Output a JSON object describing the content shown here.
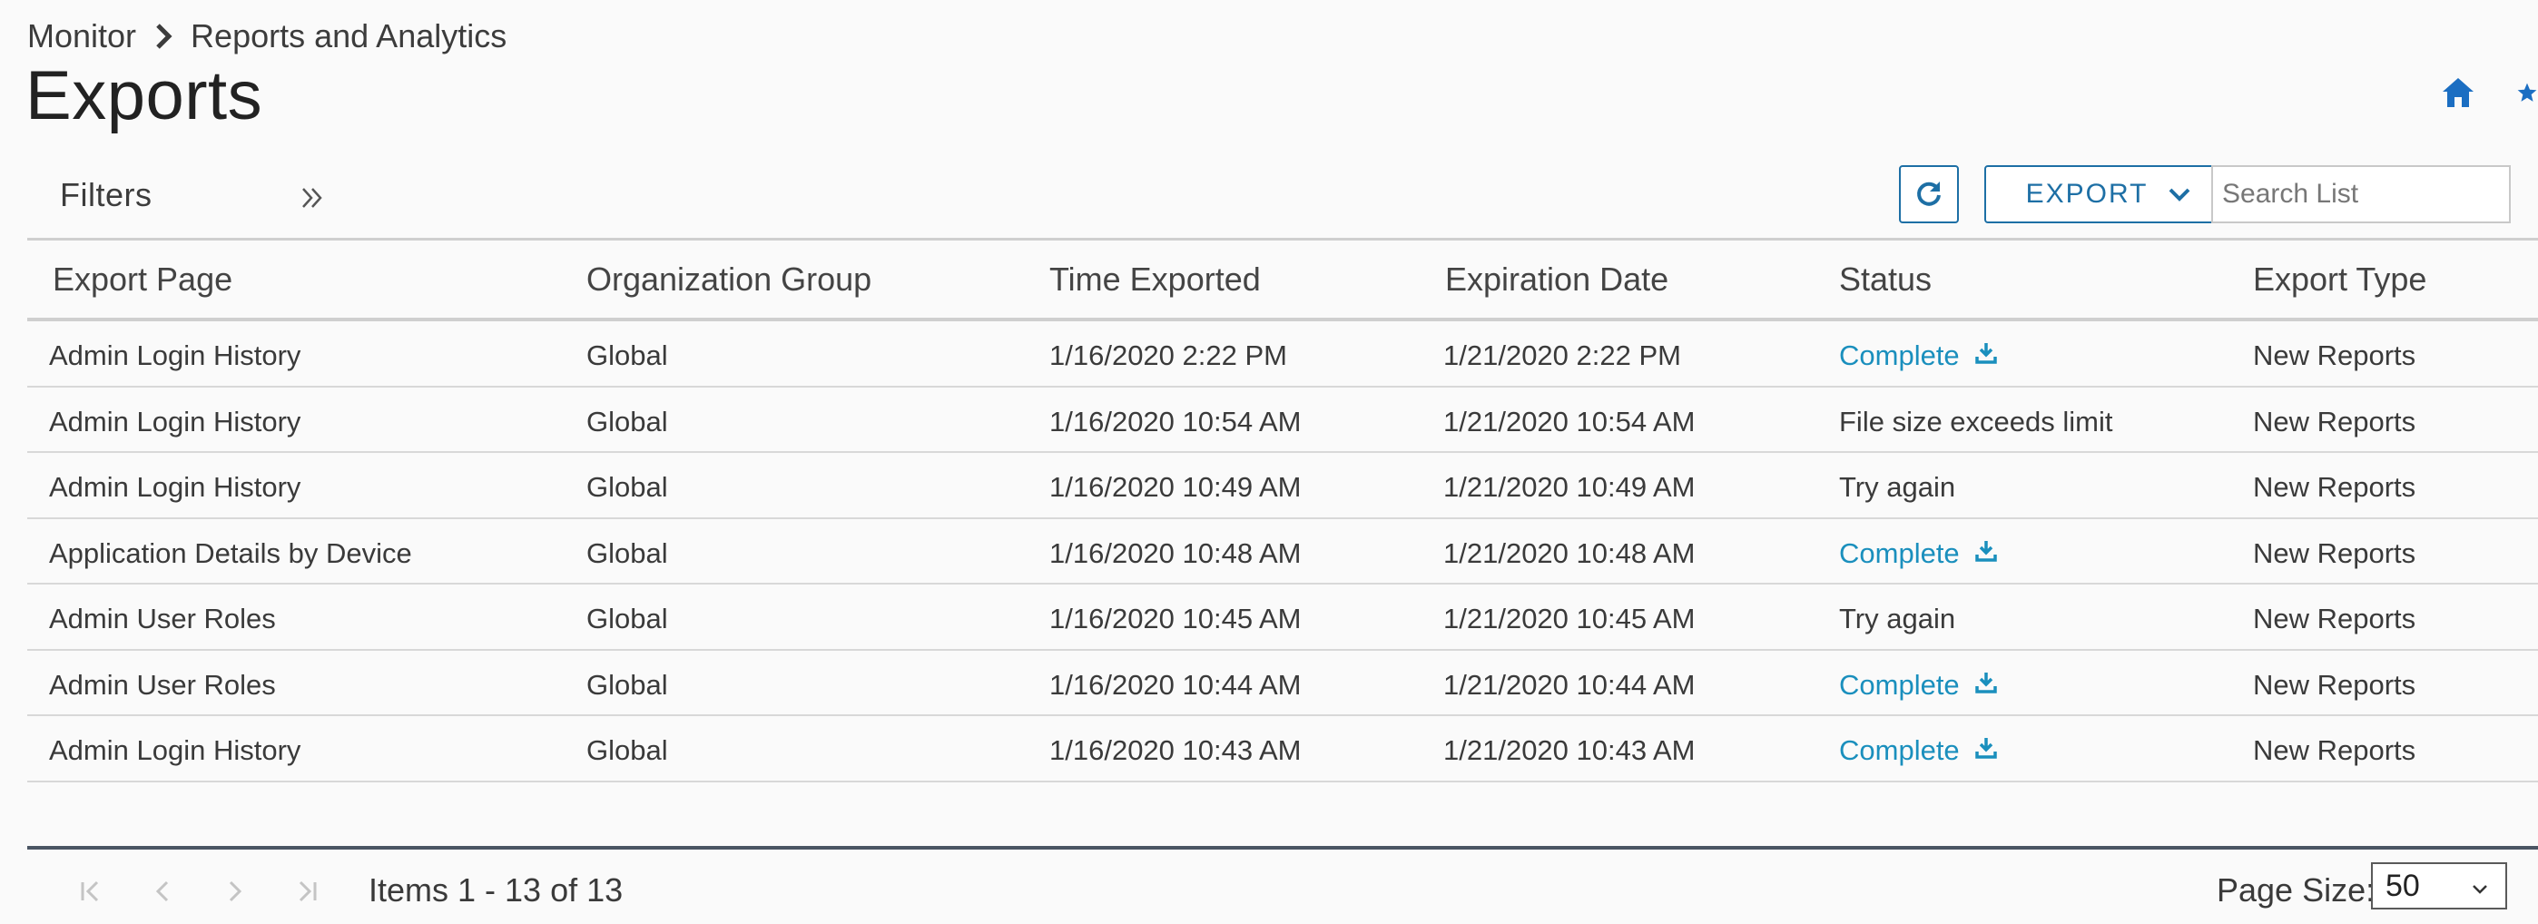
{
  "breadcrumb": {
    "items": [
      "Monitor",
      "Reports and Analytics"
    ]
  },
  "page": {
    "title": "Exports"
  },
  "colors": {
    "accent": "#1d6fa5",
    "link": "#1a8fbd",
    "icon": "#1b6ec2"
  },
  "toolbar": {
    "filters_label": "Filters",
    "export_label": "EXPORT",
    "search_placeholder": "Search List"
  },
  "grid": {
    "columns": [
      "Export Page",
      "Organization Group",
      "Time Exported",
      "Expiration Date",
      "Status",
      "Export Type"
    ],
    "rows": [
      {
        "export_page": "Admin Login History",
        "org_group": "Global",
        "time_exported": "1/16/2020 2:22 PM",
        "expiration_date": "1/21/2020 2:22 PM",
        "status": "Complete",
        "export_type": "New Reports"
      },
      {
        "export_page": "Admin Login History",
        "org_group": "Global",
        "time_exported": "1/16/2020 10:54 AM",
        "expiration_date": "1/21/2020 10:54 AM",
        "status": "File size exceeds limit",
        "export_type": "New Reports"
      },
      {
        "export_page": "Admin Login History",
        "org_group": "Global",
        "time_exported": "1/16/2020 10:49 AM",
        "expiration_date": "1/21/2020 10:49 AM",
        "status": "Try again",
        "export_type": "New Reports"
      },
      {
        "export_page": "Application Details by Device",
        "org_group": "Global",
        "time_exported": "1/16/2020 10:48 AM",
        "expiration_date": "1/21/2020 10:48 AM",
        "status": "Complete",
        "export_type": "New Reports"
      },
      {
        "export_page": "Admin User Roles",
        "org_group": "Global",
        "time_exported": "1/16/2020 10:45 AM",
        "expiration_date": "1/21/2020 10:45 AM",
        "status": "Try again",
        "export_type": "New Reports"
      },
      {
        "export_page": "Admin User Roles",
        "org_group": "Global",
        "time_exported": "1/16/2020 10:44 AM",
        "expiration_date": "1/21/2020 10:44 AM",
        "status": "Complete",
        "export_type": "New Reports"
      },
      {
        "export_page": "Admin Login History",
        "org_group": "Global",
        "time_exported": "1/16/2020 10:43 AM",
        "expiration_date": "1/21/2020 10:43 AM",
        "status": "Complete",
        "export_type": "New Reports"
      }
    ]
  },
  "pager": {
    "items_text": "Items 1 - 13 of 13",
    "page_size_label": "Page Size:",
    "page_size_value": "50"
  },
  "icons": {
    "breadcrumb_separator": "chevron-right-icon",
    "home": "home-icon",
    "favorite": "star-icon",
    "filters_toggle": "double-chevron-right-icon",
    "refresh": "refresh-icon",
    "export_dropdown": "chevron-down-icon",
    "download": "download-icon",
    "pager_first": "first-page-icon",
    "pager_prev": "prev-page-icon",
    "pager_next": "next-page-icon",
    "pager_last": "last-page-icon"
  }
}
